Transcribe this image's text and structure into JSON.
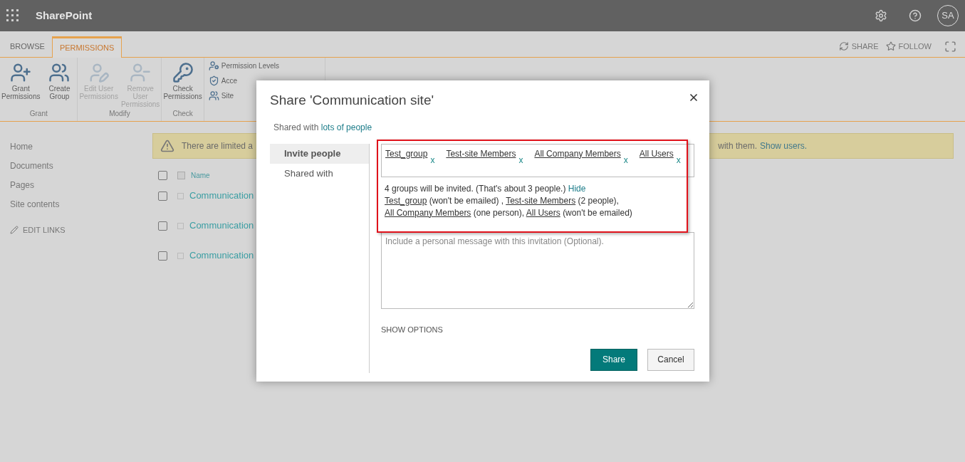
{
  "suite_bar": {
    "app_name": "SharePoint",
    "avatar": "SA"
  },
  "ribbon": {
    "tabs": [
      {
        "label": "BROWSE",
        "selected": false
      },
      {
        "label": "PERMISSIONS",
        "selected": true
      }
    ],
    "actions": [
      {
        "label": "SHARE",
        "kind": "share"
      },
      {
        "label": "FOLLOW",
        "kind": "follow"
      }
    ],
    "groups": [
      {
        "name": "Grant",
        "buttons": [
          {
            "label": "Grant Permissions",
            "kind": "grant",
            "disabled": false
          },
          {
            "label": "Create Group",
            "kind": "group",
            "disabled": false
          }
        ]
      },
      {
        "name": "Modify",
        "buttons": [
          {
            "label": "Edit User Permissions",
            "kind": "edit",
            "disabled": true
          },
          {
            "label": "Remove User Permissions",
            "kind": "remove",
            "disabled": true
          }
        ]
      },
      {
        "name": "Check",
        "buttons": [
          {
            "label": "Check Permissions",
            "kind": "check",
            "disabled": false
          }
        ]
      }
    ],
    "small_buttons": [
      "Permission Levels",
      "Acce",
      "Site"
    ]
  },
  "nav": {
    "items": [
      "Home",
      "Documents",
      "Pages",
      "Site contents"
    ],
    "edit_links": "EDIT LINKS"
  },
  "warning": {
    "text_start": "There are limited a",
    "text_end": "with them.",
    "link": "Show users."
  },
  "list": {
    "column": "Name",
    "select_all": {
      "checked": false
    },
    "select_all_items": {
      "disabled": true
    },
    "rows": [
      {
        "title": "Communication",
        "checked": false
      },
      {
        "title": "Communication",
        "checked": false
      },
      {
        "title": "Communication",
        "checked": false
      }
    ]
  },
  "dialog": {
    "title": "Share 'Communication site'",
    "shared_with": "Shared with",
    "shared_link": "lots of people",
    "tabs": [
      {
        "label": "Invite people",
        "selected": true
      },
      {
        "label": "Shared with",
        "selected": false
      }
    ],
    "tokens": [
      {
        "name": "Test_group",
        "remove": "x"
      },
      {
        "name": "Test-site Members",
        "remove": "x"
      },
      {
        "name": "All Company Members",
        "remove": "x"
      },
      {
        "name": "All Users",
        "remove": "x"
      }
    ],
    "summary": "4 groups will be invited. (That's about 3 people.)",
    "hide": "Hide",
    "details": [
      {
        "name": "Test_group",
        "note": "(won't be emailed) ,"
      },
      {
        "name": "Test-site Members",
        "note": "(2 people),"
      },
      {
        "name": "All Company Members",
        "note": "(one person),"
      },
      {
        "name": "All Users",
        "note": "(won't be emailed)"
      }
    ],
    "message_placeholder": "Include a personal message with this invitation (Optional).",
    "show_options": "SHOW OPTIONS",
    "buttons": [
      {
        "label": "Share",
        "kind": "primary"
      },
      {
        "label": "Cancel",
        "kind": "secondary"
      }
    ]
  }
}
